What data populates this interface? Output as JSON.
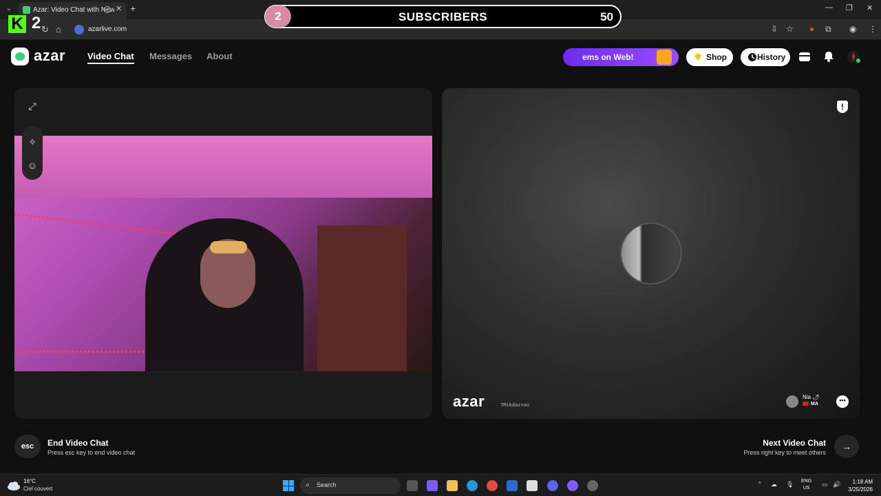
{
  "browser": {
    "tab_title": "Azar: Video Chat with New",
    "url": "azarlive.com"
  },
  "overlay": {
    "left_count": "2",
    "label": "SUBSCRIBERS",
    "right_count": "50",
    "kick_count": "2"
  },
  "header": {
    "brand": "azar",
    "nav": [
      "Video Chat",
      "Messages",
      "About"
    ],
    "promo_text": "ems on Web!",
    "shop_label": "Shop",
    "history_label": "History"
  },
  "remote": {
    "watermark": "azar",
    "watermark_id": "7Mikdaz+oo",
    "partner_name": "Nia 🌶",
    "partner_country": "MA"
  },
  "controls": {
    "esc_label": "esc",
    "end_title": "End Video Chat",
    "end_sub": "Press esc key to end video chat",
    "next_title": "Next Video Chat",
    "next_sub": "Press right key to meet others"
  },
  "taskbar": {
    "temp": "16°C",
    "condition": "Ciel couvert",
    "search": "Search",
    "lang1": "ENG",
    "lang2": "US",
    "time": "1:18 AM",
    "date": "3/25/2026"
  },
  "colors": {
    "accent_green": "#2fd47b",
    "promo_purple": "#7b3bf5",
    "banner_pink": "#d78aa6"
  }
}
